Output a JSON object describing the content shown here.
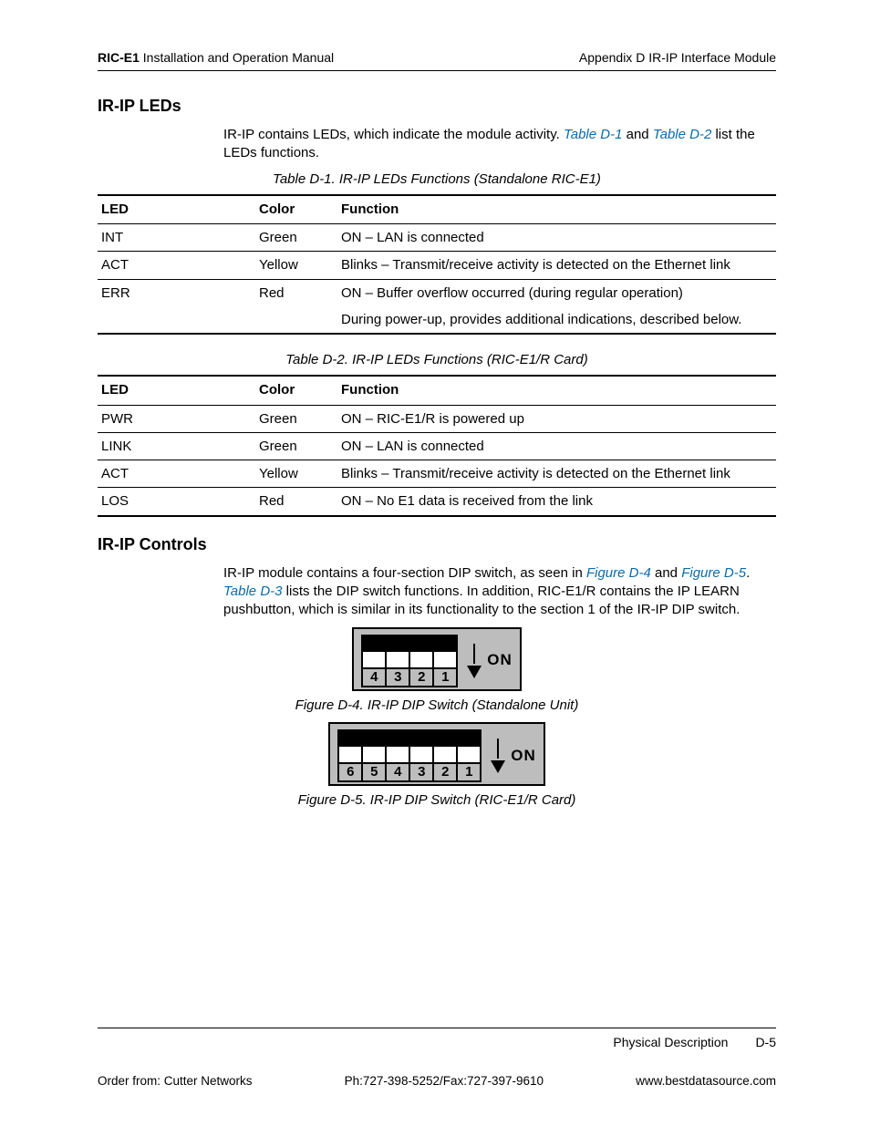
{
  "header": {
    "left_bold": "RIC-E1",
    "left_rest": " Installation and Operation Manual",
    "right": "Appendix D  IR-IP Interface Module"
  },
  "section1": {
    "title": "IR-IP LEDs",
    "para_pre": "IR-IP contains LEDs, which indicate the module activity. ",
    "link1": "Table D-1",
    "mid": " and ",
    "link2": "Table D-2",
    "para_post": " list the LEDs functions."
  },
  "table1": {
    "caption": "Table D-1.  IR-IP LEDs Functions (Standalone RIC-E1)",
    "headers": [
      "LED",
      "Color",
      "Function"
    ],
    "rows": [
      {
        "led": "INT",
        "color": "Green",
        "func": "ON – LAN is connected",
        "sep": true
      },
      {
        "led": "ACT",
        "color": "Yellow",
        "func": "Blinks – Transmit/receive activity is detected on the Ethernet link",
        "sep": true
      },
      {
        "led": "ERR",
        "color": "Red",
        "func": "ON – Buffer overflow occurred (during regular operation)",
        "sep": false
      },
      {
        "led": "",
        "color": "",
        "func": "During power-up, provides additional indications, described below.",
        "sep": false,
        "last": true
      }
    ]
  },
  "table2": {
    "caption": "Table D-2.  IR-IP LEDs Functions (RIC-E1/R Card)",
    "headers": [
      "LED",
      "Color",
      "Function"
    ],
    "rows": [
      {
        "led": "PWR",
        "color": "Green",
        "func": "ON – RIC-E1/R is powered up",
        "sep": true
      },
      {
        "led": "LINK",
        "color": "Green",
        "func": "ON – LAN is connected",
        "sep": true
      },
      {
        "led": "ACT",
        "color": "Yellow",
        "func": "Blinks – Transmit/receive activity is detected on the Ethernet link",
        "sep": true
      },
      {
        "led": "LOS",
        "color": "Red",
        "func": "ON – No E1 data is received from the link",
        "sep": false,
        "last": true
      }
    ]
  },
  "section2": {
    "title": "IR-IP Controls",
    "p_pre": "IR-IP module contains a four-section DIP switch, as seen in ",
    "linkA": "Figure D-4",
    "p_mid1": " and ",
    "linkB": "Figure D-5",
    "p_mid2": ". ",
    "linkC": "Table D-3",
    "p_post": " lists the DIP switch functions. In addition, RIC-E1/R contains the IP LEARN pushbutton, which is similar in its functionality to the section 1 of the IR-IP DIP switch."
  },
  "figures": {
    "on_label": "ON",
    "fig4": {
      "caption": "Figure D-4.  IR-IP DIP Switch (Standalone Unit)",
      "numbers": [
        "4",
        "3",
        "2",
        "1"
      ]
    },
    "fig5": {
      "caption": "Figure D-5.  IR-IP DIP Switch (RIC-E1/R Card)",
      "numbers": [
        "6",
        "5",
        "4",
        "3",
        "2",
        "1"
      ]
    }
  },
  "footer": {
    "section": "Physical Description",
    "page": "D-5",
    "order": "Order from: Cutter Networks",
    "phone": "Ph:727-398-5252/Fax:727-397-9610",
    "url": "www.bestdatasource.com"
  }
}
